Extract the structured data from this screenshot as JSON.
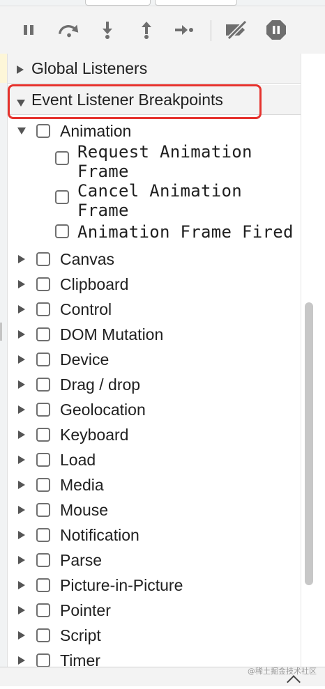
{
  "toolbar": {
    "buttons": [
      {
        "name": "pause-button",
        "icon": "pause-icon"
      },
      {
        "name": "step-over-button",
        "icon": "step-over-icon"
      },
      {
        "name": "step-into-button",
        "icon": "step-into-icon"
      },
      {
        "name": "step-out-button",
        "icon": "step-out-icon"
      },
      {
        "name": "step-button",
        "icon": "step-icon"
      },
      {
        "name": "deactivate-breakpoints-button",
        "icon": "deactivate-breakpoints-icon"
      },
      {
        "name": "pause-on-exceptions-button",
        "icon": "pause-on-exceptions-icon"
      }
    ]
  },
  "sections": {
    "global_listeners": "Global Listeners",
    "event_listener_breakpoints": "Event Listener Breakpoints"
  },
  "animation": {
    "label": "Animation",
    "expanded": true,
    "items": [
      {
        "line1": "Request Animation",
        "line2": "Frame"
      },
      {
        "line1": "Cancel Animation",
        "line2": "Frame"
      },
      {
        "line1": "Animation Frame Fired",
        "line2": ""
      }
    ]
  },
  "categories": [
    "Canvas",
    "Clipboard",
    "Control",
    "DOM Mutation",
    "Device",
    "Drag / drop",
    "Geolocation",
    "Keyboard",
    "Load",
    "Media",
    "Mouse",
    "Notification",
    "Parse",
    "Picture-in-Picture",
    "Pointer",
    "Script",
    "Timer"
  ],
  "watermark": "@稀土掘金技术社区",
  "colors": {
    "highlight": "#e5322d",
    "icon": "#6e6e6e",
    "header_bg": "#f3f3f3"
  }
}
